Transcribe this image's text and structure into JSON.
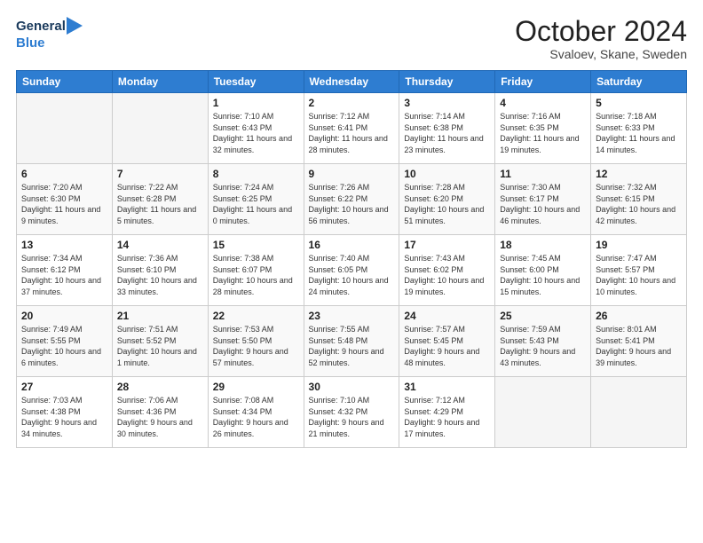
{
  "header": {
    "logo_general": "General",
    "logo_blue": "Blue",
    "month_title": "October 2024",
    "location": "Svaloev, Skane, Sweden"
  },
  "days_of_week": [
    "Sunday",
    "Monday",
    "Tuesday",
    "Wednesday",
    "Thursday",
    "Friday",
    "Saturday"
  ],
  "weeks": [
    [
      {
        "day": "",
        "sunrise": "",
        "sunset": "",
        "daylight": ""
      },
      {
        "day": "",
        "sunrise": "",
        "sunset": "",
        "daylight": ""
      },
      {
        "day": "1",
        "sunrise": "Sunrise: 7:10 AM",
        "sunset": "Sunset: 6:43 PM",
        "daylight": "Daylight: 11 hours and 32 minutes."
      },
      {
        "day": "2",
        "sunrise": "Sunrise: 7:12 AM",
        "sunset": "Sunset: 6:41 PM",
        "daylight": "Daylight: 11 hours and 28 minutes."
      },
      {
        "day": "3",
        "sunrise": "Sunrise: 7:14 AM",
        "sunset": "Sunset: 6:38 PM",
        "daylight": "Daylight: 11 hours and 23 minutes."
      },
      {
        "day": "4",
        "sunrise": "Sunrise: 7:16 AM",
        "sunset": "Sunset: 6:35 PM",
        "daylight": "Daylight: 11 hours and 19 minutes."
      },
      {
        "day": "5",
        "sunrise": "Sunrise: 7:18 AM",
        "sunset": "Sunset: 6:33 PM",
        "daylight": "Daylight: 11 hours and 14 minutes."
      }
    ],
    [
      {
        "day": "6",
        "sunrise": "Sunrise: 7:20 AM",
        "sunset": "Sunset: 6:30 PM",
        "daylight": "Daylight: 11 hours and 9 minutes."
      },
      {
        "day": "7",
        "sunrise": "Sunrise: 7:22 AM",
        "sunset": "Sunset: 6:28 PM",
        "daylight": "Daylight: 11 hours and 5 minutes."
      },
      {
        "day": "8",
        "sunrise": "Sunrise: 7:24 AM",
        "sunset": "Sunset: 6:25 PM",
        "daylight": "Daylight: 11 hours and 0 minutes."
      },
      {
        "day": "9",
        "sunrise": "Sunrise: 7:26 AM",
        "sunset": "Sunset: 6:22 PM",
        "daylight": "Daylight: 10 hours and 56 minutes."
      },
      {
        "day": "10",
        "sunrise": "Sunrise: 7:28 AM",
        "sunset": "Sunset: 6:20 PM",
        "daylight": "Daylight: 10 hours and 51 minutes."
      },
      {
        "day": "11",
        "sunrise": "Sunrise: 7:30 AM",
        "sunset": "Sunset: 6:17 PM",
        "daylight": "Daylight: 10 hours and 46 minutes."
      },
      {
        "day": "12",
        "sunrise": "Sunrise: 7:32 AM",
        "sunset": "Sunset: 6:15 PM",
        "daylight": "Daylight: 10 hours and 42 minutes."
      }
    ],
    [
      {
        "day": "13",
        "sunrise": "Sunrise: 7:34 AM",
        "sunset": "Sunset: 6:12 PM",
        "daylight": "Daylight: 10 hours and 37 minutes."
      },
      {
        "day": "14",
        "sunrise": "Sunrise: 7:36 AM",
        "sunset": "Sunset: 6:10 PM",
        "daylight": "Daylight: 10 hours and 33 minutes."
      },
      {
        "day": "15",
        "sunrise": "Sunrise: 7:38 AM",
        "sunset": "Sunset: 6:07 PM",
        "daylight": "Daylight: 10 hours and 28 minutes."
      },
      {
        "day": "16",
        "sunrise": "Sunrise: 7:40 AM",
        "sunset": "Sunset: 6:05 PM",
        "daylight": "Daylight: 10 hours and 24 minutes."
      },
      {
        "day": "17",
        "sunrise": "Sunrise: 7:43 AM",
        "sunset": "Sunset: 6:02 PM",
        "daylight": "Daylight: 10 hours and 19 minutes."
      },
      {
        "day": "18",
        "sunrise": "Sunrise: 7:45 AM",
        "sunset": "Sunset: 6:00 PM",
        "daylight": "Daylight: 10 hours and 15 minutes."
      },
      {
        "day": "19",
        "sunrise": "Sunrise: 7:47 AM",
        "sunset": "Sunset: 5:57 PM",
        "daylight": "Daylight: 10 hours and 10 minutes."
      }
    ],
    [
      {
        "day": "20",
        "sunrise": "Sunrise: 7:49 AM",
        "sunset": "Sunset: 5:55 PM",
        "daylight": "Daylight: 10 hours and 6 minutes."
      },
      {
        "day": "21",
        "sunrise": "Sunrise: 7:51 AM",
        "sunset": "Sunset: 5:52 PM",
        "daylight": "Daylight: 10 hours and 1 minute."
      },
      {
        "day": "22",
        "sunrise": "Sunrise: 7:53 AM",
        "sunset": "Sunset: 5:50 PM",
        "daylight": "Daylight: 9 hours and 57 minutes."
      },
      {
        "day": "23",
        "sunrise": "Sunrise: 7:55 AM",
        "sunset": "Sunset: 5:48 PM",
        "daylight": "Daylight: 9 hours and 52 minutes."
      },
      {
        "day": "24",
        "sunrise": "Sunrise: 7:57 AM",
        "sunset": "Sunset: 5:45 PM",
        "daylight": "Daylight: 9 hours and 48 minutes."
      },
      {
        "day": "25",
        "sunrise": "Sunrise: 7:59 AM",
        "sunset": "Sunset: 5:43 PM",
        "daylight": "Daylight: 9 hours and 43 minutes."
      },
      {
        "day": "26",
        "sunrise": "Sunrise: 8:01 AM",
        "sunset": "Sunset: 5:41 PM",
        "daylight": "Daylight: 9 hours and 39 minutes."
      }
    ],
    [
      {
        "day": "27",
        "sunrise": "Sunrise: 7:03 AM",
        "sunset": "Sunset: 4:38 PM",
        "daylight": "Daylight: 9 hours and 34 minutes."
      },
      {
        "day": "28",
        "sunrise": "Sunrise: 7:06 AM",
        "sunset": "Sunset: 4:36 PM",
        "daylight": "Daylight: 9 hours and 30 minutes."
      },
      {
        "day": "29",
        "sunrise": "Sunrise: 7:08 AM",
        "sunset": "Sunset: 4:34 PM",
        "daylight": "Daylight: 9 hours and 26 minutes."
      },
      {
        "day": "30",
        "sunrise": "Sunrise: 7:10 AM",
        "sunset": "Sunset: 4:32 PM",
        "daylight": "Daylight: 9 hours and 21 minutes."
      },
      {
        "day": "31",
        "sunrise": "Sunrise: 7:12 AM",
        "sunset": "Sunset: 4:29 PM",
        "daylight": "Daylight: 9 hours and 17 minutes."
      },
      {
        "day": "",
        "sunrise": "",
        "sunset": "",
        "daylight": ""
      },
      {
        "day": "",
        "sunrise": "",
        "sunset": "",
        "daylight": ""
      }
    ]
  ]
}
